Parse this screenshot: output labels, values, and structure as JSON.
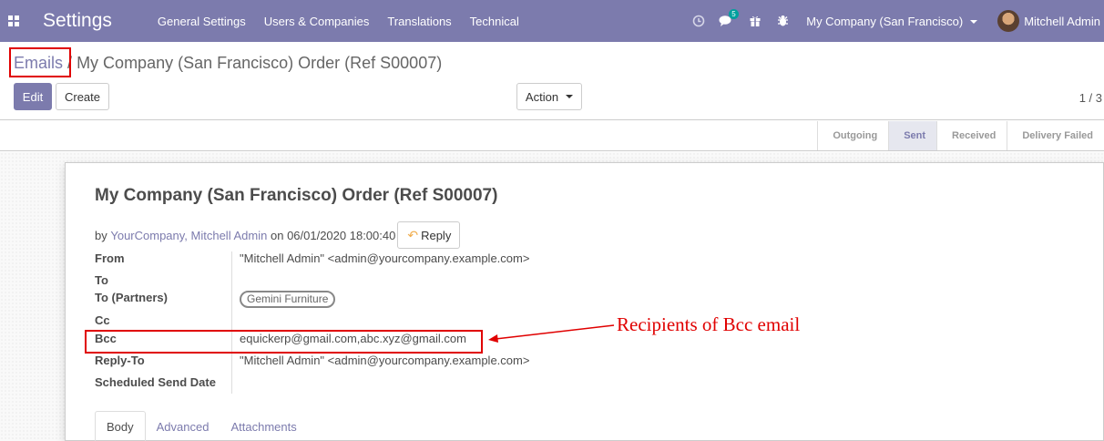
{
  "navbar": {
    "app_title": "Settings",
    "menu": [
      "General Settings",
      "Users & Companies",
      "Translations",
      "Technical"
    ],
    "chat_badge": "5",
    "company": "My Company (San Francisco)",
    "user": "Mitchell Admin"
  },
  "breadcrumb": {
    "parent": "Emails",
    "separator": "/",
    "current": "My Company (San Francisco) Order (Ref S00007)"
  },
  "buttons": {
    "edit": "Edit",
    "create": "Create",
    "action": "Action"
  },
  "pager": "1 / 3",
  "stages": [
    {
      "label": "Outgoing",
      "active": false
    },
    {
      "label": "Sent",
      "active": true
    },
    {
      "label": "Received",
      "active": false
    },
    {
      "label": "Delivery Failed",
      "active": false
    }
  ],
  "mail": {
    "subject": "My Company (San Francisco) Order (Ref S00007)",
    "by_prefix": "by",
    "author": "YourCompany, Mitchell Admin",
    "on_prefix": "on",
    "date": "06/01/2020 18:00:40",
    "reply_label": "Reply"
  },
  "fields": {
    "from_label": "From",
    "from_value": "\"Mitchell Admin\" <admin@yourcompany.example.com>",
    "to_label": "To",
    "to_value": "",
    "to_partners_label": "To (Partners)",
    "to_partners_tag": "Gemini Furniture",
    "cc_label": "Cc",
    "cc_value": "",
    "bcc_label": "Bcc",
    "bcc_value": "equickerp@gmail.com,abc.xyz@gmail.com",
    "reply_to_label": "Reply-To",
    "reply_to_value": "\"Mitchell Admin\" <admin@yourcompany.example.com>",
    "scheduled_label": "Scheduled Send Date",
    "scheduled_value": ""
  },
  "tabs": [
    "Body",
    "Advanced",
    "Attachments"
  ],
  "annotation": "Recipients of Bcc email",
  "colors": {
    "brand": "#7c7bad",
    "highlight": "#e00000",
    "badge": "#00a09d"
  }
}
